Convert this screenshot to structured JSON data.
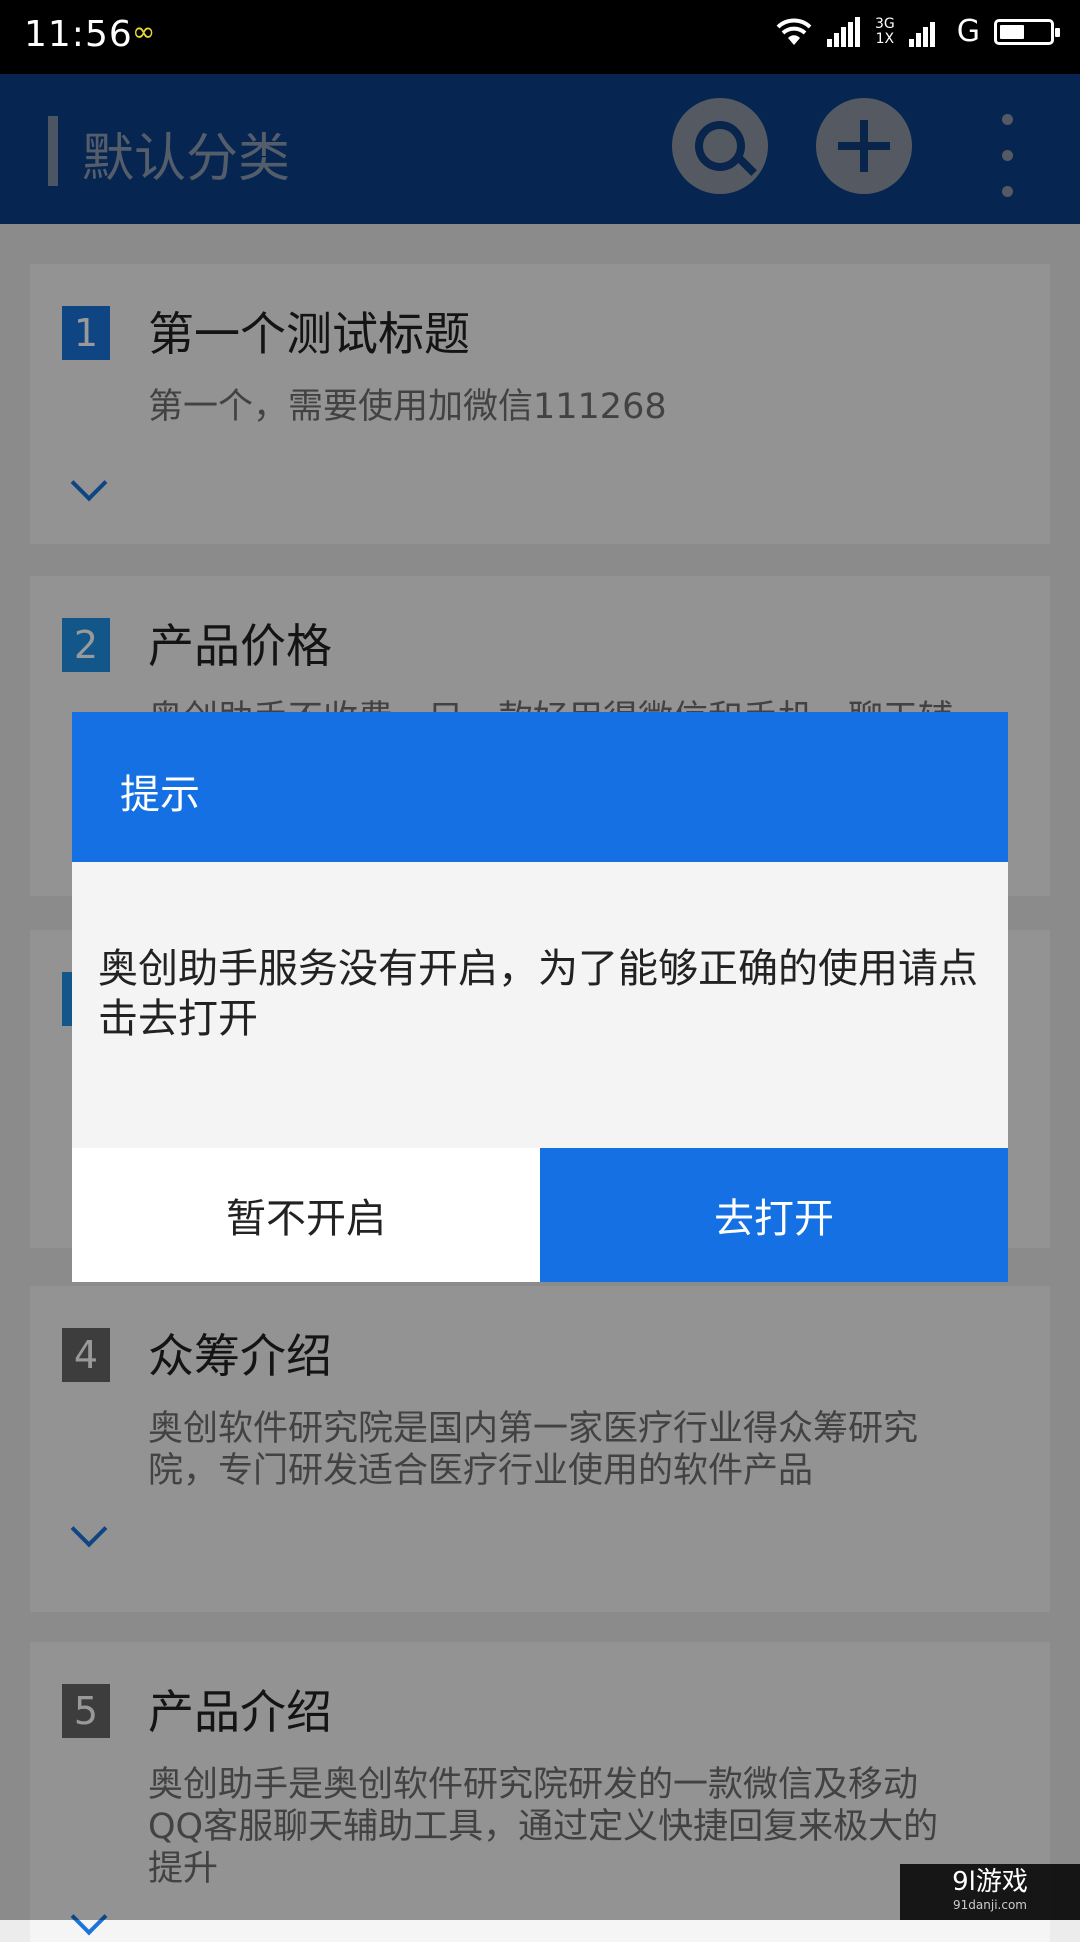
{
  "status_bar": {
    "time": "11:56",
    "network_top": "3G",
    "network_bottom": "1X",
    "network_g": "G"
  },
  "app_bar": {
    "title": "默认分类"
  },
  "cards": [
    {
      "number": "1",
      "title": "第一个测试标题",
      "body": "第一个，需要使用加微信111268"
    },
    {
      "number": "2",
      "title": "产品价格",
      "body": "奥创助手不收费，只一款好用得微信和手机，聊天辅"
    },
    {
      "number": "4",
      "title": "众筹介绍",
      "body": "奥创软件研究院是国内第一家医疗行业得众筹研究院，专门研发适合医疗行业使用的软件产品"
    },
    {
      "number": "5",
      "title": "产品介绍",
      "body": "奥创助手是奥创软件研究院研发的一款微信及移动QQ客服聊天辅助工具，通过定义快捷回复来极大的提升"
    }
  ],
  "dialog": {
    "title": "提示",
    "message": "奥创助手服务没有开启，为了能够正确的使用请点击去打开",
    "cancel_label": "暂不开启",
    "confirm_label": "去打开"
  },
  "watermark": {
    "main": "9l游戏",
    "sub": "91danji.com"
  },
  "colors": {
    "app_bar": "#0c3f88",
    "dialog_accent": "#1570e3",
    "number_blue": "#1c73dc"
  },
  "icons": {
    "search": "search-icon",
    "add": "add-icon",
    "more": "more-vertical-icon",
    "expand": "chevron-down-icon"
  }
}
